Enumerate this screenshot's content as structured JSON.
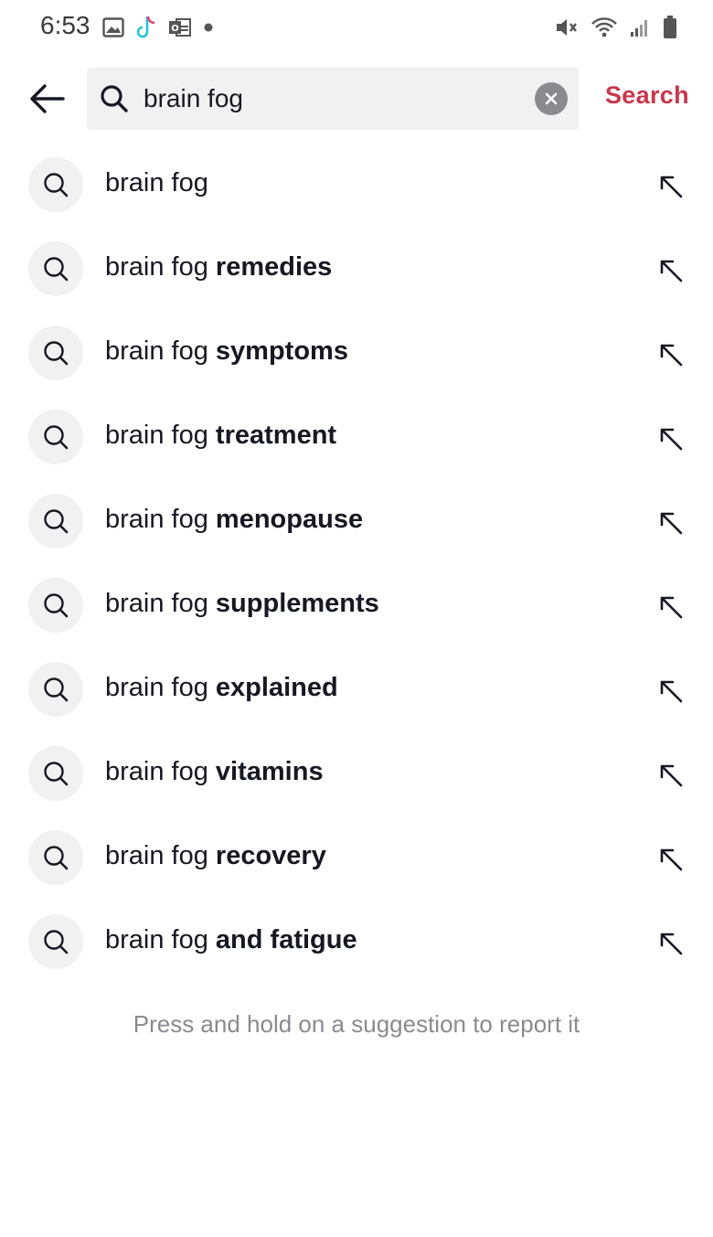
{
  "status_bar": {
    "time": "6:53",
    "left_icons": [
      "image-icon",
      "tiktok-icon",
      "outlook-icon",
      "dot-icon"
    ],
    "right_icons": [
      "mute-vibrate-icon",
      "wifi-icon",
      "signal-icon",
      "battery-icon"
    ]
  },
  "header": {
    "back_icon": "arrow-left-icon",
    "search_value": "brain fog",
    "search_icon": "search-icon",
    "clear_icon": "clear-icon",
    "submit_label": "Search"
  },
  "suggestions": [
    {
      "prefix": "brain fog",
      "suffix": ""
    },
    {
      "prefix": "brain fog ",
      "suffix": "remedies"
    },
    {
      "prefix": "brain fog ",
      "suffix": "symptoms"
    },
    {
      "prefix": "brain fog ",
      "suffix": "treatment"
    },
    {
      "prefix": "brain fog ",
      "suffix": "menopause"
    },
    {
      "prefix": "brain fog ",
      "suffix": "supplements"
    },
    {
      "prefix": "brain fog ",
      "suffix": "explained"
    },
    {
      "prefix": "brain fog ",
      "suffix": "vitamins"
    },
    {
      "prefix": "brain fog ",
      "suffix": "recovery"
    },
    {
      "prefix": "brain fog ",
      "suffix": "and fatigue"
    }
  ],
  "footer": {
    "hint": "Press and hold on a suggestion to report it"
  },
  "colors": {
    "accent": "#c7374d",
    "text": "#161823",
    "muted": "#8a8b91",
    "chip_bg": "#f1f1f2"
  }
}
